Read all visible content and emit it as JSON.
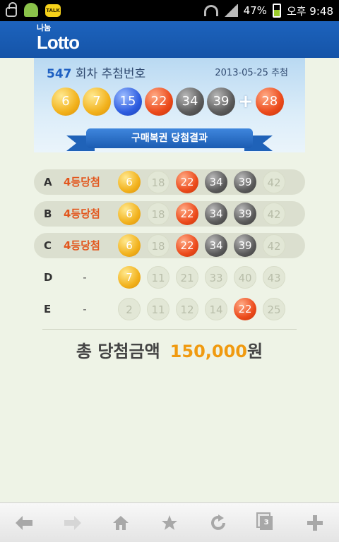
{
  "status_bar": {
    "battery": "47%",
    "time": "오후 9:48",
    "notifications": [
      "lock-icon",
      "android-icon",
      "kakaotalk-icon"
    ],
    "talk_label": "TALK"
  },
  "header": {
    "logo_small": "나눔",
    "logo_main": "Lotto"
  },
  "draw": {
    "round_number": "547",
    "round_label": "회차 추첨번호",
    "date": "2013-05-25 추첨",
    "numbers": [
      {
        "n": "6",
        "color": "yellow"
      },
      {
        "n": "7",
        "color": "yellow"
      },
      {
        "n": "15",
        "color": "blue"
      },
      {
        "n": "22",
        "color": "red"
      },
      {
        "n": "34",
        "color": "gray"
      },
      {
        "n": "39",
        "color": "gray"
      }
    ],
    "plus": "+",
    "bonus": {
      "n": "28",
      "color": "red"
    }
  },
  "banner_title": "구매복권 당첨결과",
  "tickets": [
    {
      "letter": "A",
      "result": "4등당첨",
      "won": true,
      "balls": [
        {
          "n": "6",
          "c": "yellow"
        },
        {
          "n": "18",
          "c": "faded"
        },
        {
          "n": "22",
          "c": "red"
        },
        {
          "n": "34",
          "c": "gray"
        },
        {
          "n": "39",
          "c": "gray"
        },
        {
          "n": "42",
          "c": "faded"
        }
      ]
    },
    {
      "letter": "B",
      "result": "4등당첨",
      "won": true,
      "balls": [
        {
          "n": "6",
          "c": "yellow"
        },
        {
          "n": "18",
          "c": "faded"
        },
        {
          "n": "22",
          "c": "red"
        },
        {
          "n": "34",
          "c": "gray"
        },
        {
          "n": "39",
          "c": "gray"
        },
        {
          "n": "42",
          "c": "faded"
        }
      ]
    },
    {
      "letter": "C",
      "result": "4등당첨",
      "won": true,
      "balls": [
        {
          "n": "6",
          "c": "yellow"
        },
        {
          "n": "18",
          "c": "faded"
        },
        {
          "n": "22",
          "c": "red"
        },
        {
          "n": "34",
          "c": "gray"
        },
        {
          "n": "39",
          "c": "gray"
        },
        {
          "n": "42",
          "c": "faded"
        }
      ]
    },
    {
      "letter": "D",
      "result": "-",
      "won": false,
      "balls": [
        {
          "n": "7",
          "c": "yellow"
        },
        {
          "n": "11",
          "c": "faded"
        },
        {
          "n": "21",
          "c": "faded"
        },
        {
          "n": "33",
          "c": "faded"
        },
        {
          "n": "40",
          "c": "faded"
        },
        {
          "n": "43",
          "c": "faded"
        }
      ]
    },
    {
      "letter": "E",
      "result": "-",
      "won": false,
      "balls": [
        {
          "n": "2",
          "c": "faded"
        },
        {
          "n": "11",
          "c": "faded"
        },
        {
          "n": "12",
          "c": "faded"
        },
        {
          "n": "14",
          "c": "faded"
        },
        {
          "n": "22",
          "c": "red"
        },
        {
          "n": "25",
          "c": "faded"
        }
      ]
    }
  ],
  "total": {
    "label": "총 당첨금액",
    "amount": "150,000",
    "unit": "원"
  },
  "toolbar": {
    "items": [
      "back-icon",
      "forward-icon",
      "home-icon",
      "bookmark-star-icon",
      "refresh-icon",
      "tabs-icon",
      "new-tab-plus-icon"
    ],
    "tabs_count": "3"
  },
  "colors": {
    "header_blue": "#1554a8",
    "accent_orange": "#f09a10",
    "result_red": "#e2561d",
    "background": "#eef3e6"
  }
}
